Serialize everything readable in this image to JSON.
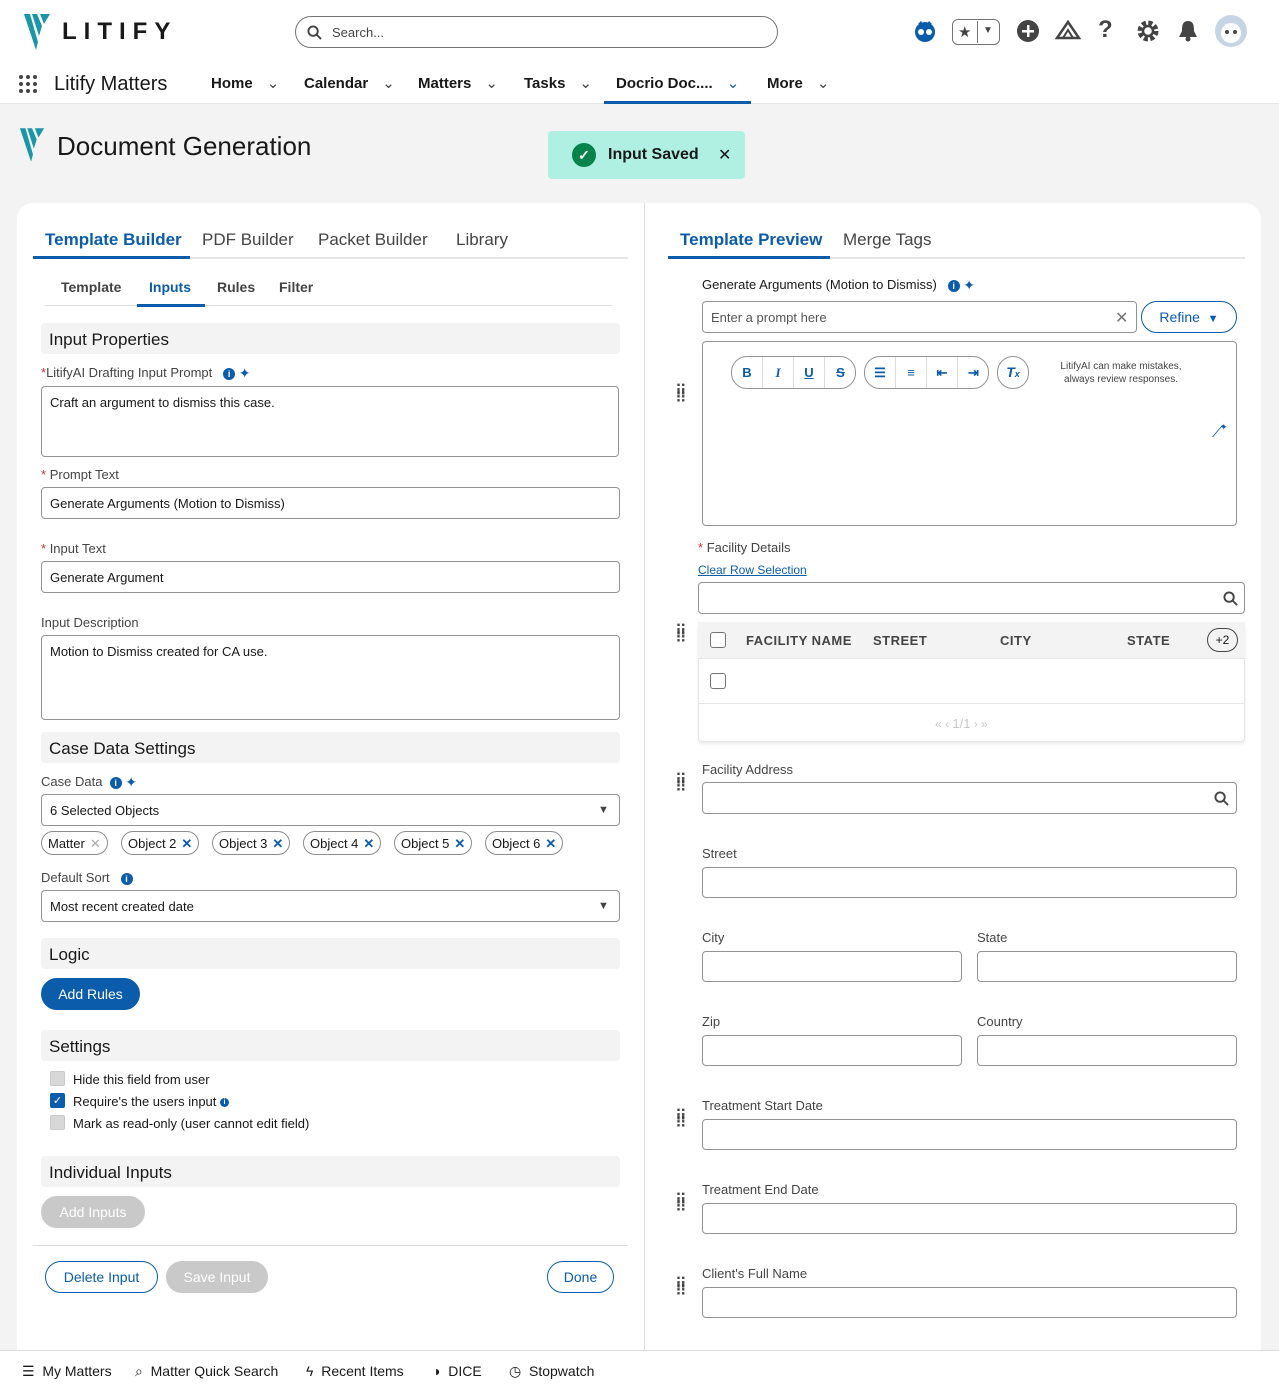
{
  "header": {
    "brand": "LITIFY",
    "search_placeholder": "Search..."
  },
  "nav": {
    "app_name": "Litify Matters",
    "items": [
      {
        "label": "Home"
      },
      {
        "label": "Calendar"
      },
      {
        "label": "Matters"
      },
      {
        "label": "Tasks"
      },
      {
        "label": "Docrio Doc...."
      },
      {
        "label": "More"
      }
    ],
    "active": "Docrio Doc...."
  },
  "page": {
    "title": "Document Generation"
  },
  "toast": {
    "message": "Input Saved"
  },
  "left": {
    "tabs": [
      "Template Builder",
      "PDF Builder",
      "Packet Builder",
      "Library"
    ],
    "subtabs": [
      "Template",
      "Inputs",
      "Rules",
      "Filter"
    ],
    "input_properties": {
      "section": "Input Properties",
      "drafting_label": "LitifyAI Drafting Input Prompt",
      "drafting_value": "Craft an argument to dismiss this case.",
      "prompt_label": "Prompt Text",
      "prompt_value": "Generate Arguments (Motion to Dismiss)",
      "input_label": "Input Text",
      "input_value": "Generate Argument",
      "desc_label": "Input Description",
      "desc_value": "Motion to Dismiss created for CA use."
    },
    "case_data": {
      "section": "Case Data Settings",
      "label": "Case Data",
      "value": "6 Selected Objects",
      "pills": [
        "Matter",
        "Object 2",
        "Object 3",
        "Object 4",
        "Object 5",
        "Object 6"
      ],
      "sort_label": "Default Sort",
      "sort_value": "Most recent created date"
    },
    "logic": {
      "section": "Logic",
      "add_rules": "Add Rules"
    },
    "settings": {
      "section": "Settings",
      "hide": "Hide this field from user",
      "require": "Require's the users input",
      "readonly": "Mark as read-only (user cannot edit field)",
      "hide_checked": false,
      "require_checked": true,
      "readonly_checked": false
    },
    "individual": {
      "section": "Individual Inputs",
      "add_inputs": "Add Inputs"
    },
    "footer": {
      "delete": "Delete Input",
      "save": "Save Input",
      "done": "Done"
    }
  },
  "right": {
    "tabs": [
      "Template Preview",
      "Merge Tags"
    ],
    "gen_label": "Generate Arguments (Motion to Dismiss)",
    "prompt_placeholder": "Enter a prompt here",
    "refine": "Refine",
    "ai_note_1": "LitifyAI can make mistakes,",
    "ai_note_2": "always review responses.",
    "facility_details": "Facility Details",
    "clear_selection": "Clear Row Selection",
    "table": {
      "columns": [
        "FACILITY NAME",
        "STREET",
        "CITY",
        "STATE"
      ],
      "more": "+2",
      "pager": "1/1"
    },
    "fields": {
      "facility_address": "Facility Address",
      "street": "Street",
      "city": "City",
      "state": "State",
      "zip": "Zip",
      "country": "Country",
      "treat_start": "Treatment Start Date",
      "treat_end": "Treatment End Date",
      "client_name": "Client's Full Name"
    }
  },
  "utility": {
    "items": [
      "My Matters",
      "Matter Quick Search",
      "Recent Items",
      "DICE",
      "Stopwatch"
    ]
  },
  "colors": {
    "brand": "#0b5cab",
    "logo": "#1b96a6",
    "toast": "#aff0e3"
  }
}
